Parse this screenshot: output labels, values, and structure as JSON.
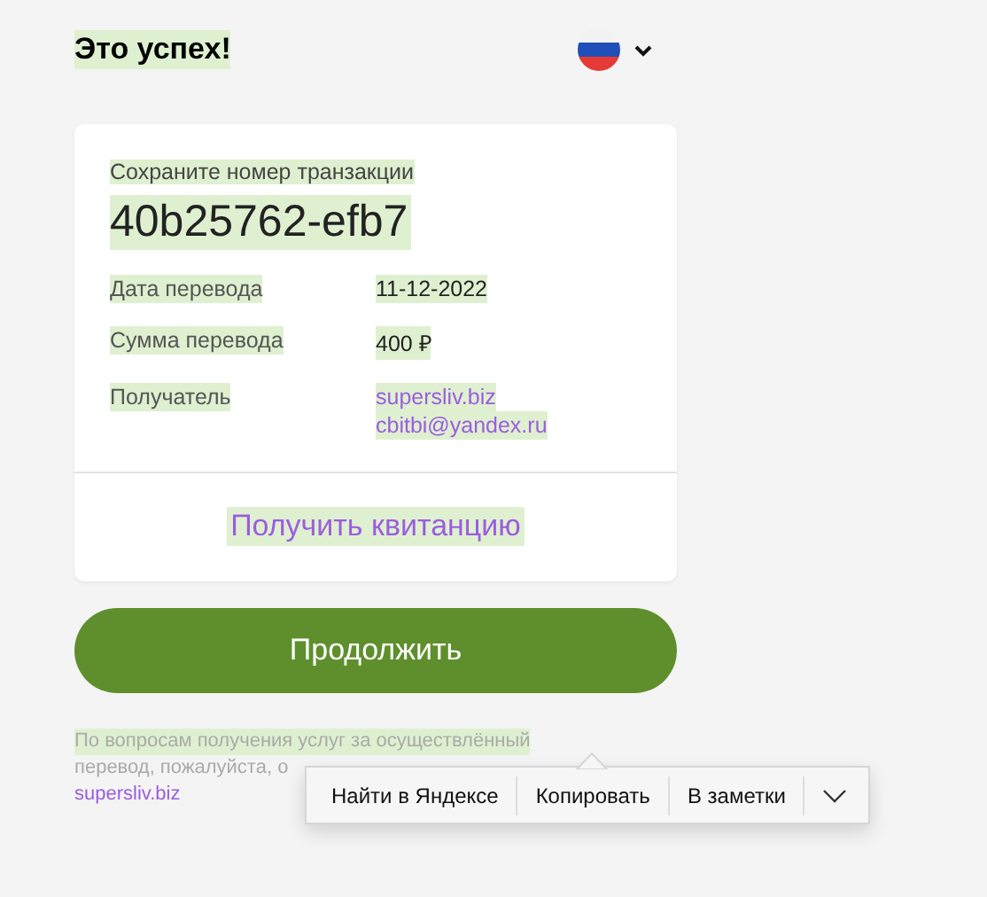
{
  "selection_highlight": true,
  "header": {
    "title": "Это успех!",
    "language": {
      "kind": "flag-ru"
    }
  },
  "card": {
    "caption": "Сохраните номер транзакции",
    "transaction_id": "40b25762-efb7",
    "details": [
      {
        "label": "Дата перевода",
        "values": [
          {
            "text": "11-12-2022",
            "kind": "text"
          }
        ]
      },
      {
        "label": "Сумма перевода",
        "values": [
          {
            "text": "400 ₽",
            "kind": "text"
          }
        ]
      },
      {
        "label": "Получатель",
        "values": [
          {
            "text": "supersliv.biz",
            "kind": "link"
          },
          {
            "text": "cbitbi@yandex.ru",
            "kind": "link"
          }
        ]
      }
    ],
    "receipt_link": "Получить квитанцию"
  },
  "continue_button": "Продолжить",
  "footer": {
    "lines": [
      "По вопросам получения услуг за осуществлённый",
      "перевод, пожалуйста, о"
    ],
    "link": "supersliv.biz"
  },
  "context_menu": {
    "items": [
      "Найти в Яндексе",
      "Копировать",
      "В заметки"
    ]
  }
}
